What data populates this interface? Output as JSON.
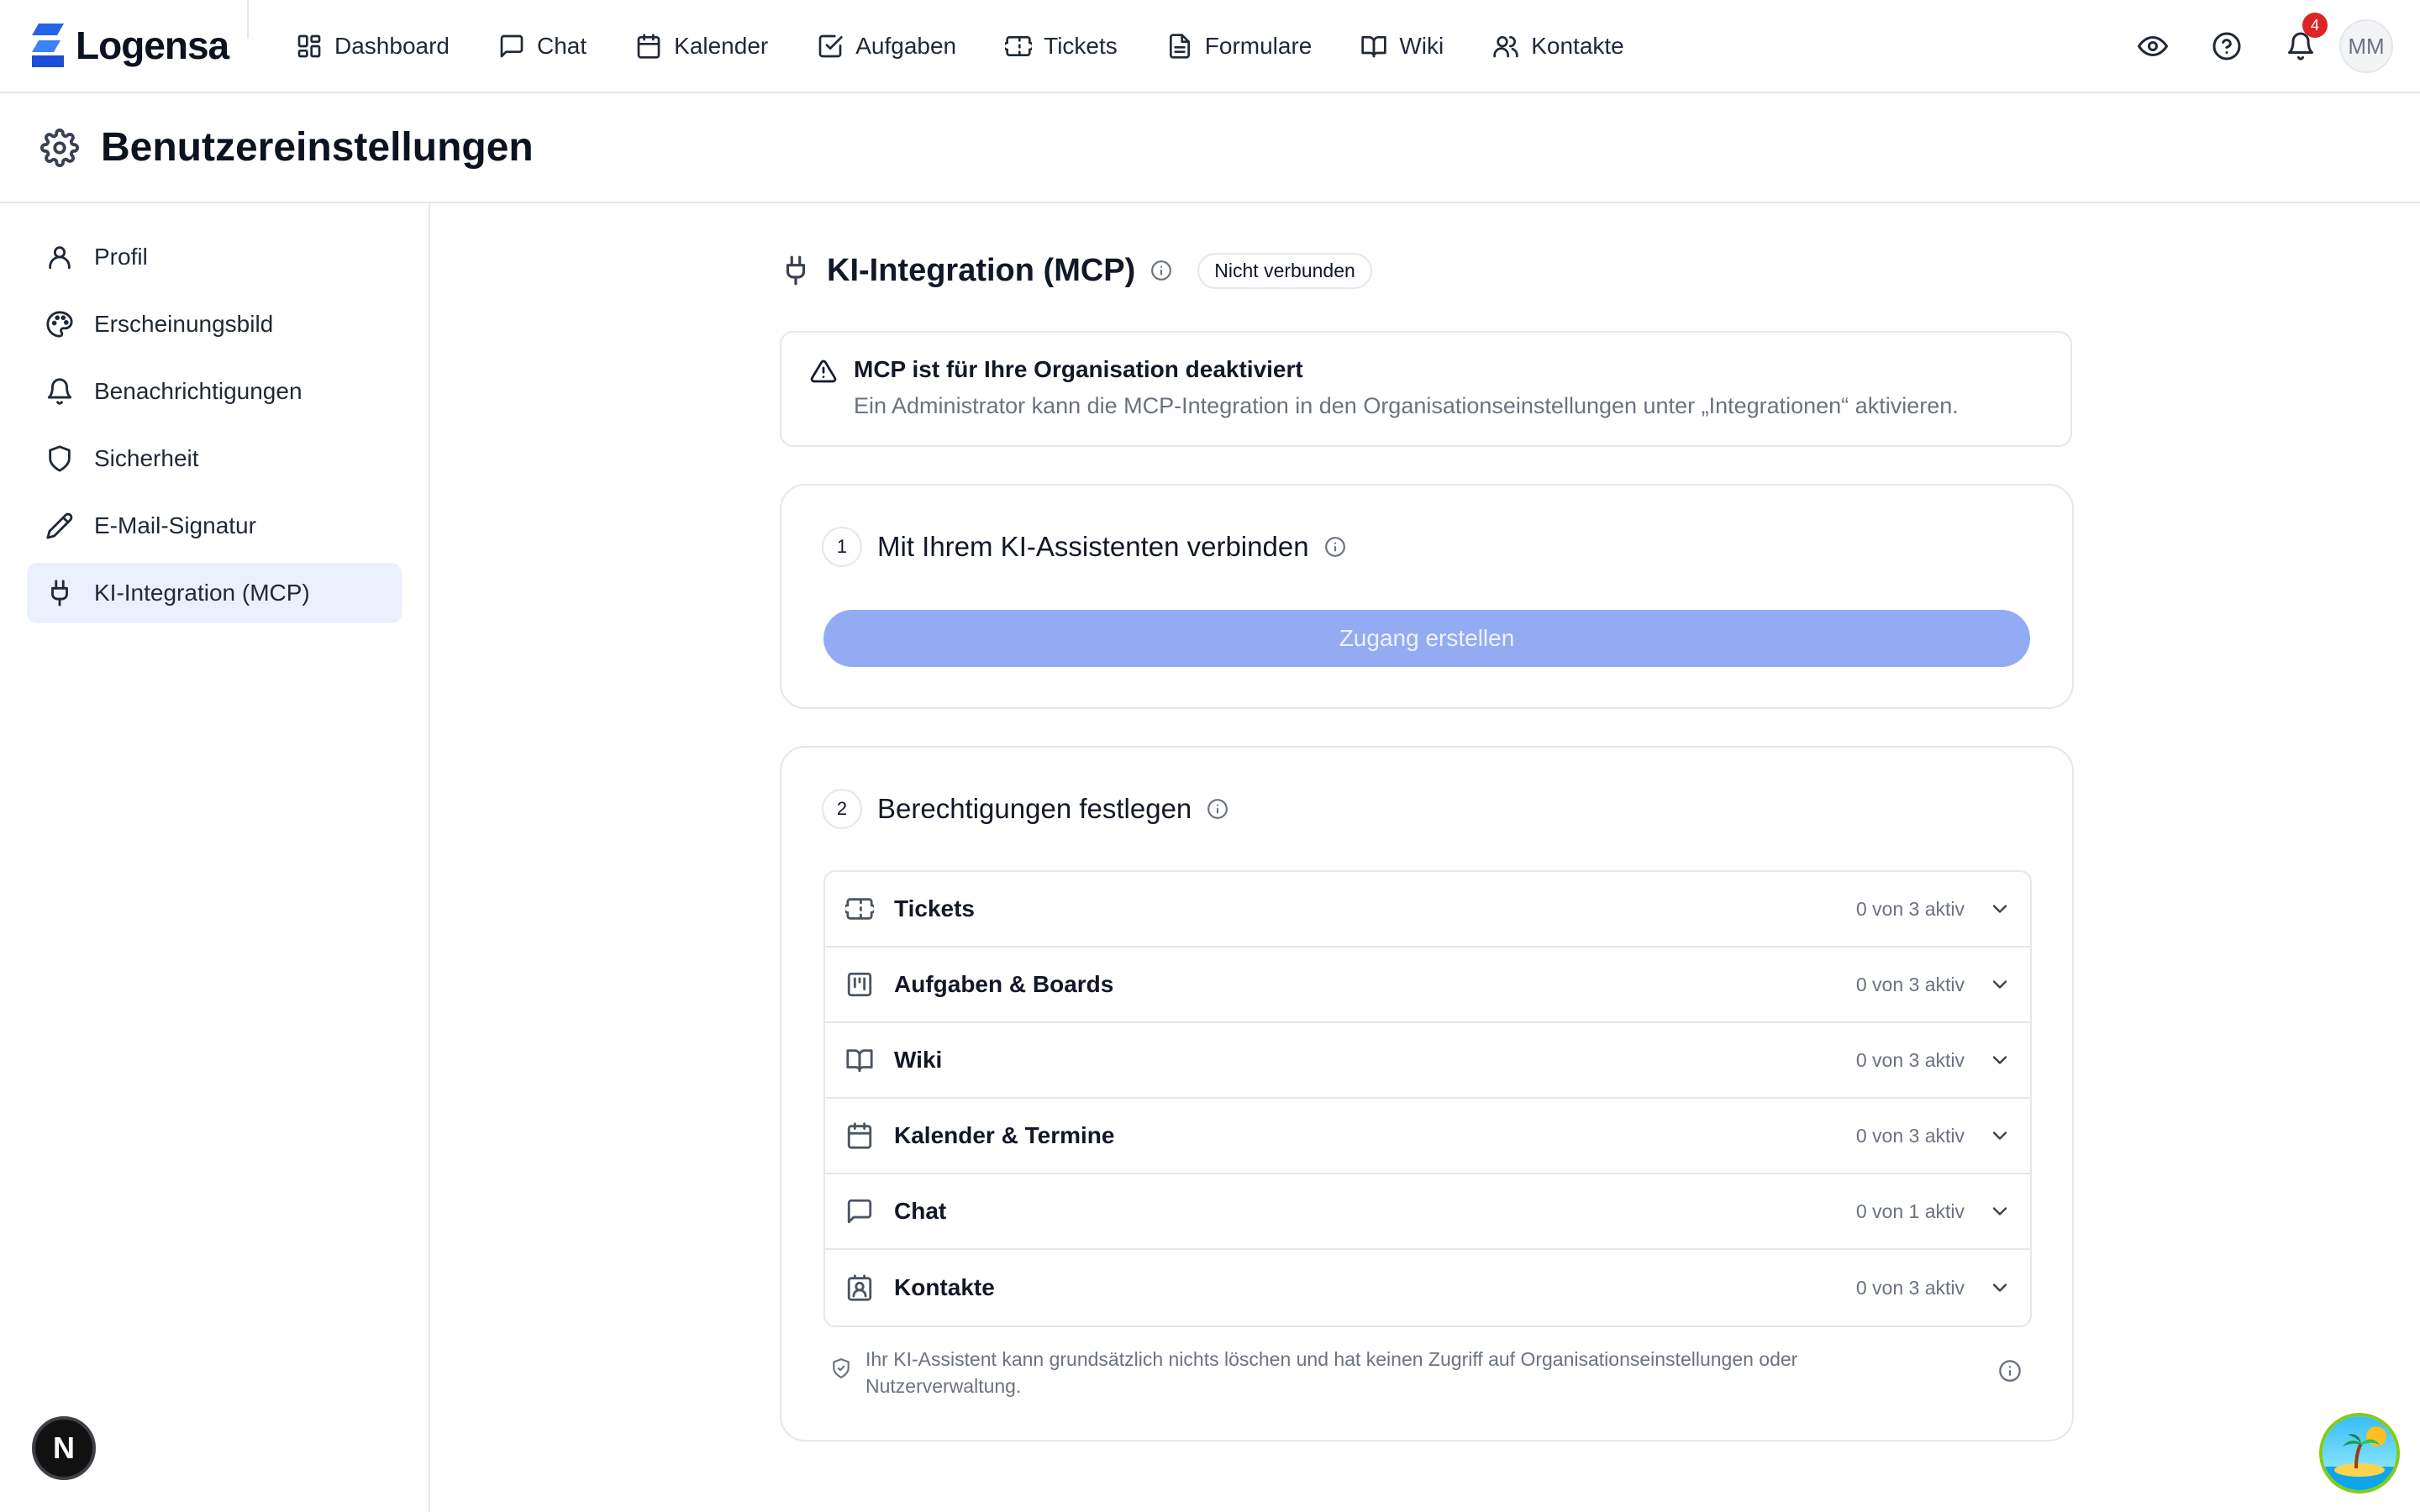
{
  "app": {
    "brand": "Logensa",
    "brand_colors": {
      "dark": "#0b1220",
      "accent": "#2563eb"
    }
  },
  "nav": {
    "items": [
      {
        "label": "Dashboard",
        "icon": "dashboard-icon"
      },
      {
        "label": "Chat",
        "icon": "chat-icon"
      },
      {
        "label": "Kalender",
        "icon": "calendar-icon"
      },
      {
        "label": "Aufgaben",
        "icon": "task-check-icon"
      },
      {
        "label": "Tickets",
        "icon": "ticket-icon"
      },
      {
        "label": "Formulare",
        "icon": "document-icon"
      },
      {
        "label": "Wiki",
        "icon": "book-icon"
      },
      {
        "label": "Kontakte",
        "icon": "contacts-icon"
      }
    ],
    "notification_count": "4",
    "avatar_initials": "MM"
  },
  "page": {
    "title": "Benutzereinstellungen"
  },
  "sidebar": {
    "items": [
      {
        "label": "Profil",
        "icon": "user-icon"
      },
      {
        "label": "Erscheinungsbild",
        "icon": "palette-icon"
      },
      {
        "label": "Benachrichtigungen",
        "icon": "bell-icon"
      },
      {
        "label": "Sicherheit",
        "icon": "shield-icon"
      },
      {
        "label": "E-Mail-Signatur",
        "icon": "pen-icon"
      },
      {
        "label": "KI-Integration (MCP)",
        "icon": "plug-icon",
        "active": true
      }
    ]
  },
  "section": {
    "title": "KI-Integration (MCP)",
    "status": "Nicht verbunden"
  },
  "alert": {
    "title": "MCP ist für Ihre Organisation deaktiviert",
    "text": "Ein Administrator kann die MCP-Integration in den Organisationseinstellungen unter „Integrationen“ aktivieren."
  },
  "step1": {
    "number": "1",
    "title": "Mit Ihrem KI-Assistenten verbinden",
    "button": "Zugang erstellen",
    "button_color": "#93abf3"
  },
  "step2": {
    "number": "2",
    "title": "Berechtigungen festlegen",
    "permissions": [
      {
        "name": "Tickets",
        "count": "0 von 3 aktiv",
        "icon": "ticket-icon"
      },
      {
        "name": "Aufgaben & Boards",
        "count": "0 von 3 aktiv",
        "icon": "kanban-icon"
      },
      {
        "name": "Wiki",
        "count": "0 von 3 aktiv",
        "icon": "book-icon"
      },
      {
        "name": "Kalender & Termine",
        "count": "0 von 3 aktiv",
        "icon": "calendar-icon"
      },
      {
        "name": "Chat",
        "count": "0 von 1 aktiv",
        "icon": "chat-icon"
      },
      {
        "name": "Kontakte",
        "count": "0 von 3 aktiv",
        "icon": "contact-card-icon"
      }
    ],
    "footnote": "Ihr KI-Assistent kann grundsätzlich nichts löschen und hat keinen Zugriff auf Organisationseinstellungen oder Nutzerverwaltung."
  },
  "floating": {
    "dev_badge": "N"
  }
}
